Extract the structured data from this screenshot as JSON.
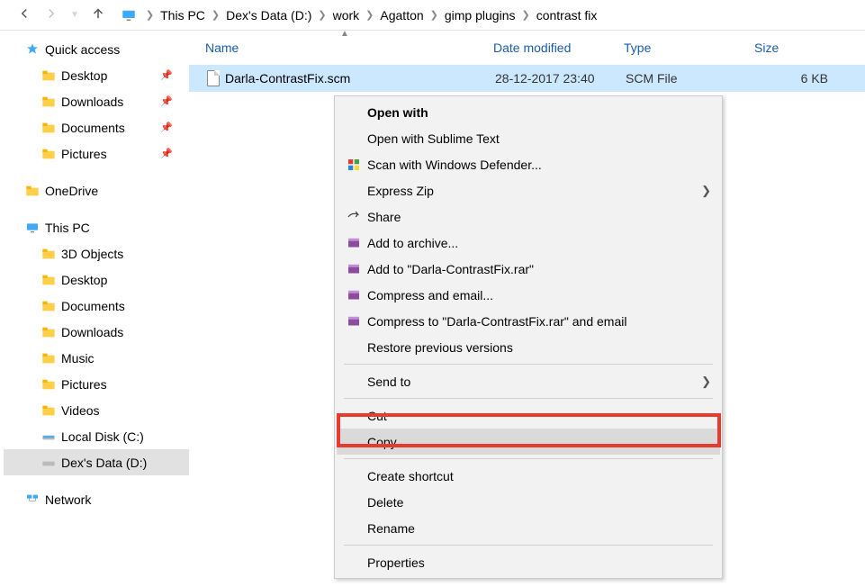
{
  "breadcrumbs": [
    "This PC",
    "Dex's Data (D:)",
    "work",
    "Agatton",
    "gimp plugins",
    "contrast fix"
  ],
  "columns": {
    "name": "Name",
    "date": "Date modified",
    "type": "Type",
    "size": "Size"
  },
  "row": {
    "name": "Darla-ContrastFix.scm",
    "date": "28-12-2017 23:40",
    "type": "SCM File",
    "size": "6 KB"
  },
  "sidebar": {
    "quick_access": "Quick access",
    "qa": [
      "Desktop",
      "Downloads",
      "Documents",
      "Pictures"
    ],
    "onedrive": "OneDrive",
    "this_pc": "This PC",
    "pc": [
      "3D Objects",
      "Desktop",
      "Documents",
      "Downloads",
      "Music",
      "Pictures",
      "Videos",
      "Local Disk (C:)",
      "Dex's Data (D:)"
    ],
    "network": "Network"
  },
  "ctx": {
    "open_with": "Open with",
    "open_sublime": "Open with Sublime Text",
    "defender": "Scan with Windows Defender...",
    "express_zip": "Express Zip",
    "share": "Share",
    "add_archive": "Add to archive...",
    "add_rar": "Add to \"Darla-ContrastFix.rar\"",
    "compress_email": "Compress and email...",
    "compress_rar_email": "Compress to \"Darla-ContrastFix.rar\" and email",
    "restore": "Restore previous versions",
    "send_to": "Send to",
    "cut": "Cut",
    "copy": "Copy",
    "shortcut": "Create shortcut",
    "delete": "Delete",
    "rename": "Rename",
    "properties": "Properties"
  }
}
